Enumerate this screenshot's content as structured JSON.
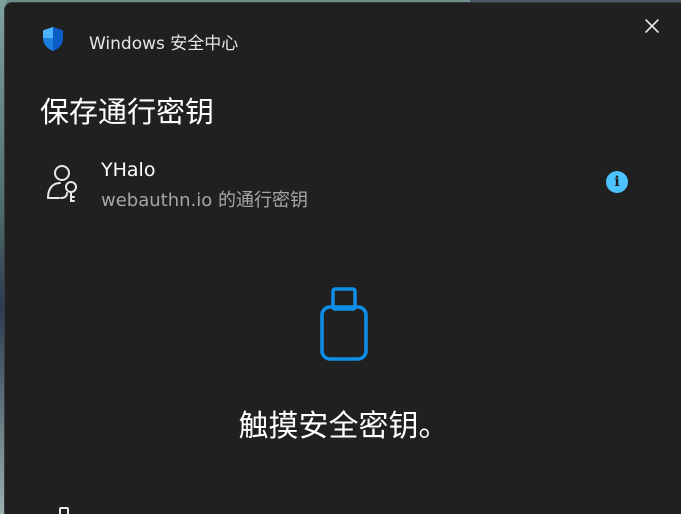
{
  "window": {
    "title": "Windows 安全中心",
    "icon": "shield-icon",
    "close_icon": "close-icon"
  },
  "dialog": {
    "heading": "保存通行密钥"
  },
  "passkey": {
    "icon": "person-key-icon",
    "name": "YHalo",
    "subtitle": "webauthn.io 的通行密钥",
    "info_label": "i"
  },
  "prompt": {
    "icon": "usb-security-key-icon",
    "instruction": "触摸安全密钥。"
  },
  "colors": {
    "background": "#202020",
    "accent": "#4cc2ff",
    "key_icon": "#0f8ee8",
    "text_primary": "#ffffff",
    "text_secondary": "#a6a6a6"
  }
}
